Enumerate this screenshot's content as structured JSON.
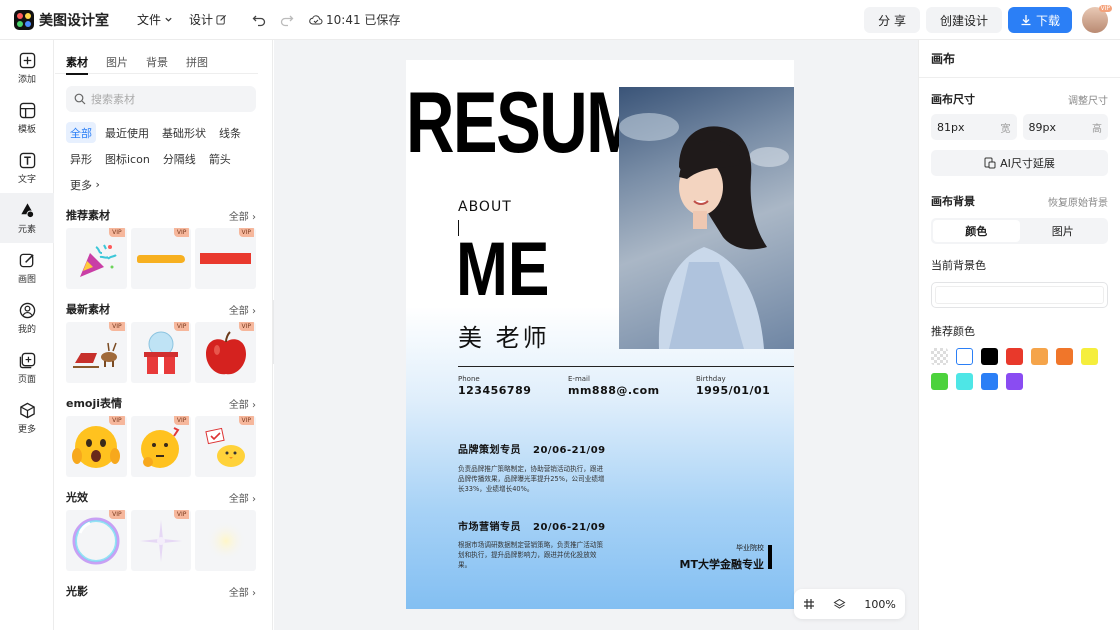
{
  "app": {
    "name": "美图设计室",
    "logo_colors": [
      "#ff5a5a",
      "#ffd84a",
      "#4ad46b",
      "#4a8bff"
    ]
  },
  "topbar": {
    "menu_file": "文件",
    "menu_design": "设计",
    "saved_status": "10:41 已保存",
    "share_label": "分 享",
    "create_label": "创建设计",
    "download_label": "下载",
    "avatar_badge": "VIP"
  },
  "rail": {
    "add": "添加",
    "template": "模板",
    "text": "文字",
    "element": "元素",
    "draw": "画图",
    "mine": "我的",
    "page": "页面",
    "more": "更多"
  },
  "panel": {
    "tabs": [
      "素材",
      "图片",
      "背景",
      "拼图"
    ],
    "search_placeholder": "搜索素材",
    "chips": [
      "全部",
      "最近使用",
      "基础形状",
      "线条",
      "异形",
      "图标icon",
      "分隔线",
      "箭头",
      "更多"
    ],
    "sections": [
      {
        "title": "推荐素材",
        "more": "全部"
      },
      {
        "title": "最新素材",
        "more": "全部"
      },
      {
        "title": "emoji表情",
        "more": "全部"
      },
      {
        "title": "光效",
        "more": "全部"
      },
      {
        "title": "光影",
        "more": "全部"
      }
    ],
    "vip_badge": "VIP"
  },
  "resume": {
    "title": "RESUME",
    "about": "ABOUT",
    "me": "ME",
    "name": "美 老师",
    "phone_label": "Phone",
    "phone": "123456789",
    "email_label": "E-mail",
    "email": "mm888@.com",
    "birthday_label": "Birthday",
    "birthday": "1995/01/01",
    "job1_title": "品牌策划专员",
    "job1_date": "20/06-21/09",
    "job1_text": "负责品牌推广策略制定，协助营销活动执行，跟进品牌传播效果，品牌曝光率提升25%，公司业绩增长33%，业绩增长40%。",
    "job2_title": "市场营销专员",
    "job2_date": "20/06-21/09",
    "job2_text": "根据市场调研数据制定营销策略，负责推广活动策划和执行，提升品牌影响力，跟进并优化投放效果。",
    "school_label": "毕业院校",
    "school": "MT大学金融专业"
  },
  "zoom": {
    "level": "100%"
  },
  "props": {
    "header": "画布",
    "size_label": "画布尺寸",
    "size_link": "调整尺寸",
    "width_value": "81px",
    "width_unit": "宽",
    "height_value": "89px",
    "height_unit": "高",
    "ai_button": "AI尺寸延展",
    "bg_label": "画布背景",
    "bg_link": "恢复原始背景",
    "seg_color": "颜色",
    "seg_image": "图片",
    "current_bg": "当前背景色",
    "recommend": "推荐颜色",
    "swatches": [
      "transparent",
      "#ffffff",
      "#000000",
      "#e8392b",
      "#f5a44a",
      "#f0762a",
      "#f5ee3c",
      "#4cd23c",
      "#4ee6e6",
      "#2b7ff6",
      "#8a4cf2"
    ]
  }
}
